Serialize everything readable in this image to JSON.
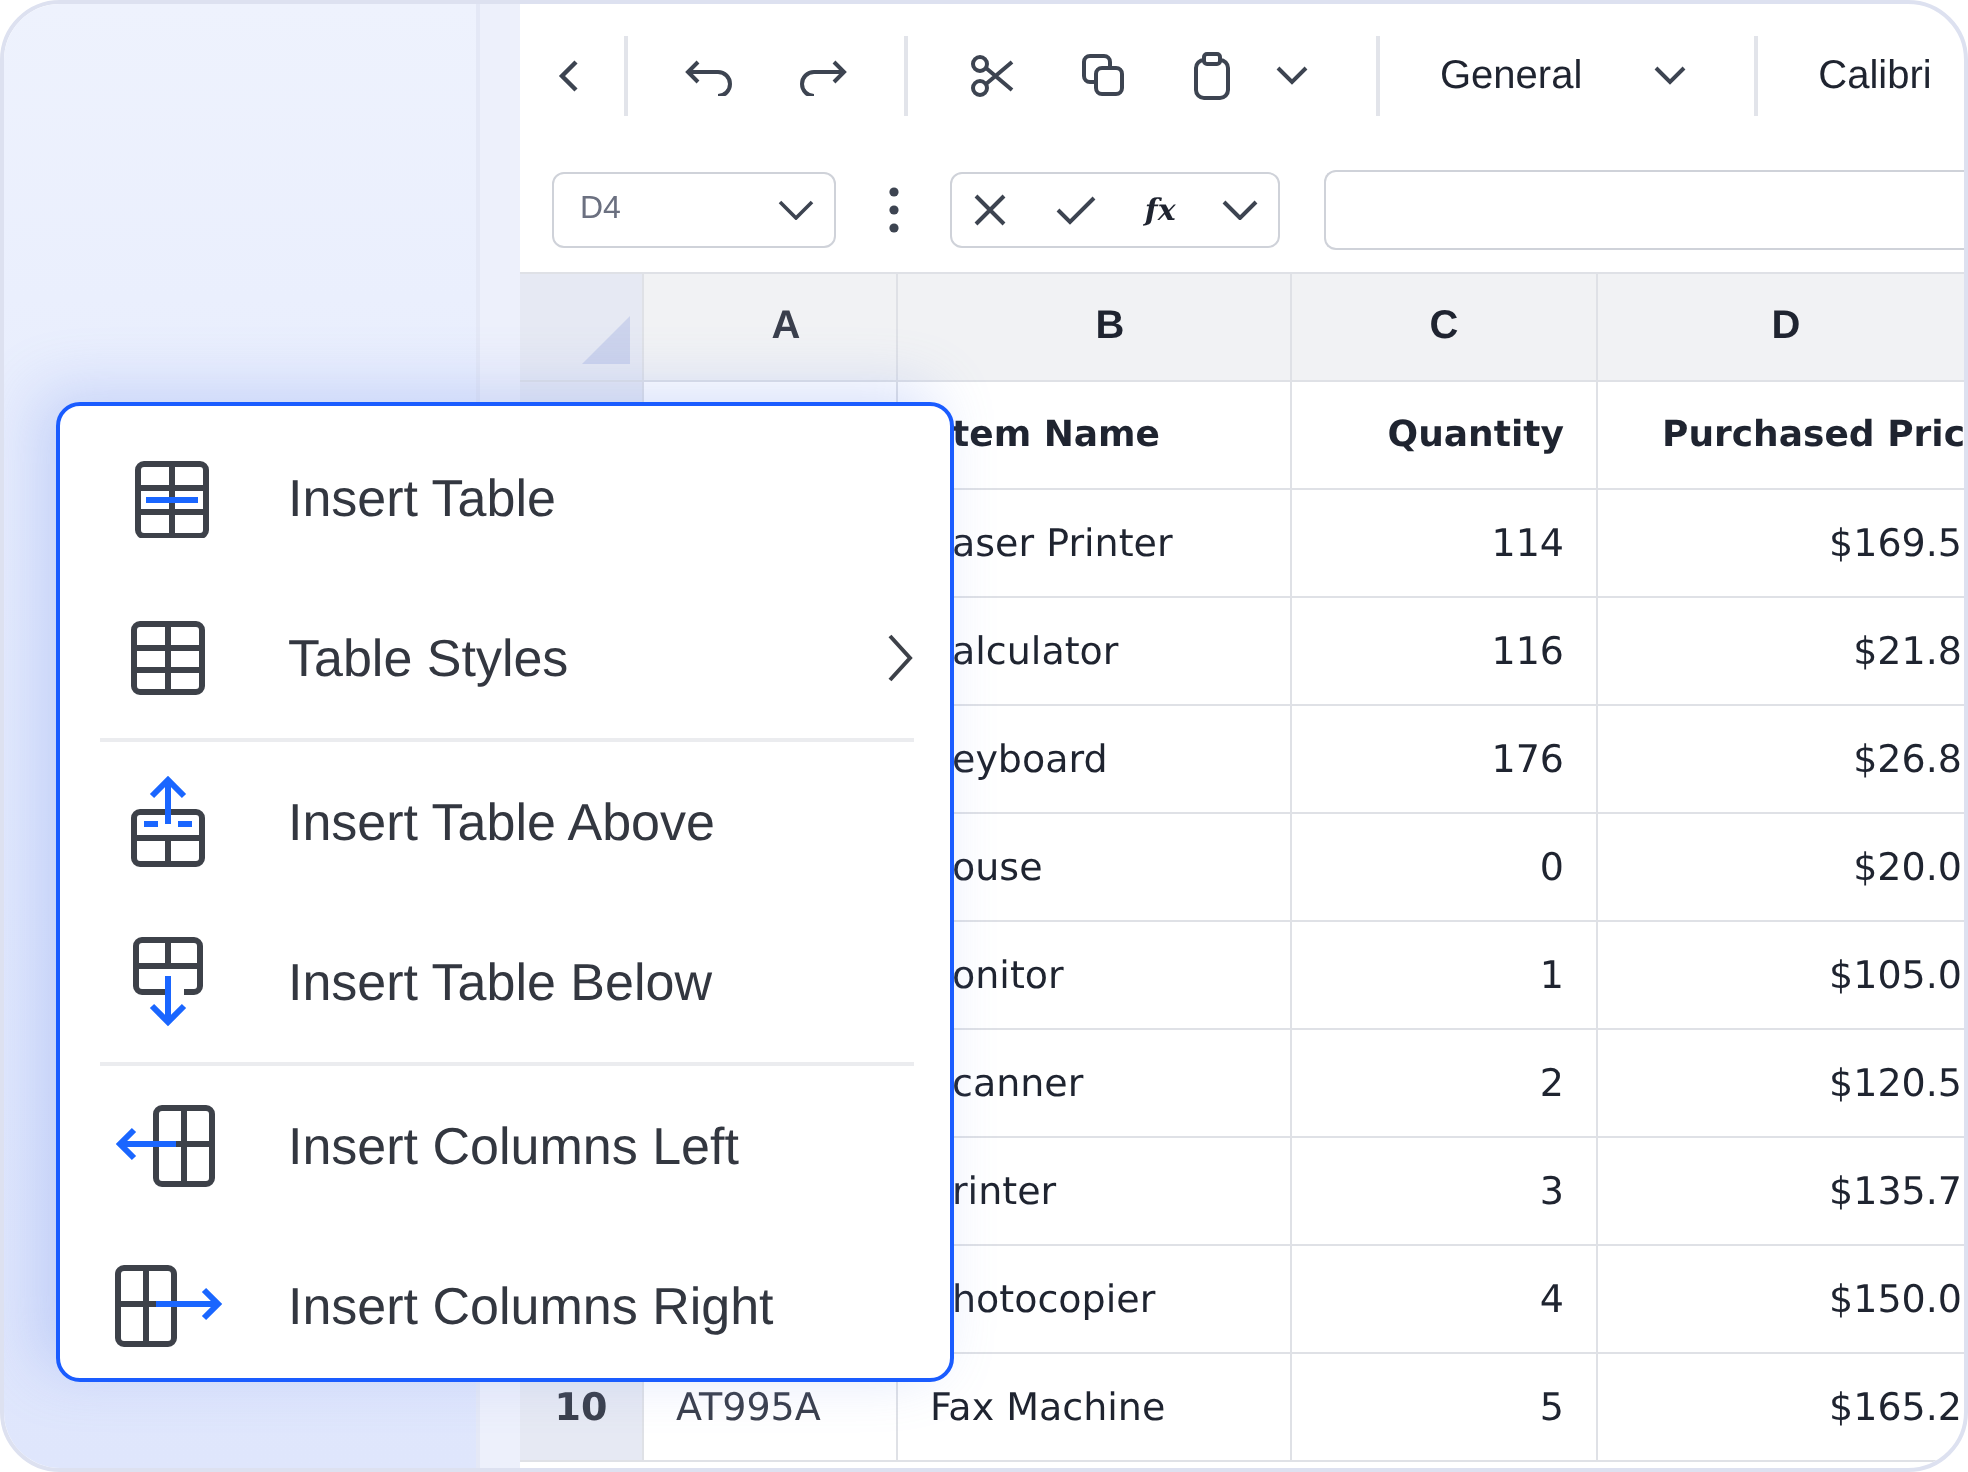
{
  "toolbar": {
    "number_format": "General",
    "font": "Calibri"
  },
  "formula_bar": {
    "cell_reference": "D4",
    "function_label": "fx"
  },
  "columns": [
    "A",
    "B",
    "C",
    "D"
  ],
  "rows": [
    {
      "kind": "heading",
      "b": "tem Name",
      "c": "Quantity",
      "d": "Purchased Pric"
    },
    {
      "kind": "data",
      "b": "aser Printer",
      "c": "114",
      "d": "$169.5"
    },
    {
      "kind": "data",
      "b": "alculator",
      "c": "116",
      "d": "$21.8"
    },
    {
      "kind": "data",
      "b": "eyboard",
      "c": "176",
      "d": "$26.8"
    },
    {
      "kind": "data",
      "b": "ouse",
      "c": "0",
      "d": "$20.0"
    },
    {
      "kind": "data",
      "b": "onitor",
      "c": "1",
      "d": "$105.0"
    },
    {
      "kind": "data",
      "b": "canner",
      "c": "2",
      "d": "$120.5"
    },
    {
      "kind": "data",
      "b": "rinter",
      "c": "3",
      "d": "$135.7"
    },
    {
      "kind": "data",
      "b": "hotocopier",
      "c": "4",
      "d": "$150.0"
    },
    {
      "kind": "data",
      "number": "10",
      "a": "AT995A",
      "b": "Fax Machine",
      "c": "5",
      "d": "$165.2"
    }
  ],
  "context_menu": {
    "sections": [
      [
        {
          "label": "Insert Table",
          "kind": "table",
          "submenu": false
        },
        {
          "label": "Table Styles",
          "kind": "grid",
          "submenu": true
        }
      ],
      [
        {
          "label": "Insert Table Above",
          "kind": "above",
          "submenu": false
        },
        {
          "label": "Insert Table Below",
          "kind": "below",
          "submenu": false
        }
      ],
      [
        {
          "label": "Insert Columns Left",
          "kind": "left",
          "submenu": false
        },
        {
          "label": "Insert Columns Right",
          "kind": "right",
          "submenu": false
        }
      ]
    ]
  }
}
